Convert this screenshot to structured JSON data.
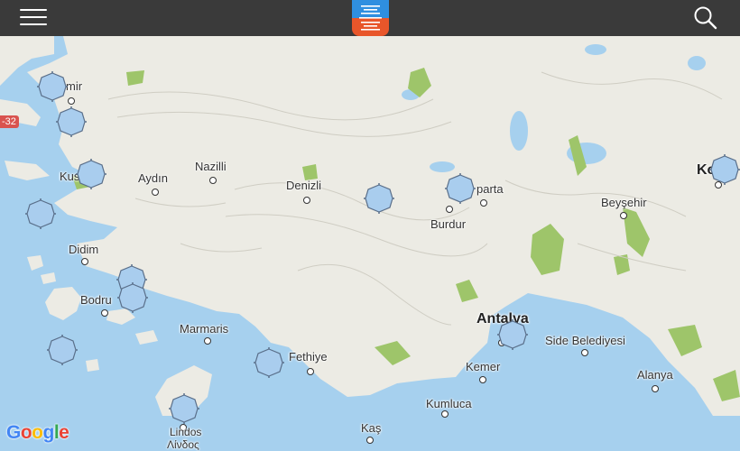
{
  "topbar": {
    "menu_icon": "hamburger-menu-icon",
    "logo_icon": "app-logo-icon",
    "search_icon": "search-icon",
    "color": "#3a3a3a",
    "logo_colors": [
      "#2f8fe0",
      "#e8562a"
    ]
  },
  "map": {
    "attribution": "Google",
    "highway_badge": "-32",
    "colors": {
      "sea": "#a6d0ee",
      "land": "#ecebe4",
      "green": "#9ec56a",
      "marker": "#a9cdee",
      "marker_border": "#5a6f8a"
    },
    "cities": [
      {
        "id": "izmir",
        "label": "mir"
      },
      {
        "id": "kusadasi",
        "label": "Kus"
      },
      {
        "id": "aydin",
        "label": "Aydın"
      },
      {
        "id": "nazilli",
        "label": "Nazilli"
      },
      {
        "id": "denizli",
        "label": "Denizli"
      },
      {
        "id": "isparta",
        "label": "parta"
      },
      {
        "id": "burdur",
        "label": "Burdur"
      },
      {
        "id": "beysehir",
        "label": "Beyşehir"
      },
      {
        "id": "konya",
        "label": "Ko"
      },
      {
        "id": "didim",
        "label": "Didim"
      },
      {
        "id": "bodrum",
        "label": "Bodru"
      },
      {
        "id": "marmaris",
        "label": "Marmaris"
      },
      {
        "id": "fethiye",
        "label": "Fethiye"
      },
      {
        "id": "antalya",
        "label": "Antalya"
      },
      {
        "id": "side",
        "label": "Side Belediyesi"
      },
      {
        "id": "kemer",
        "label": "Kemer"
      },
      {
        "id": "kumluca",
        "label": "Kumluca"
      },
      {
        "id": "alanya",
        "label": "Alanya"
      },
      {
        "id": "kas",
        "label": "Kaş"
      },
      {
        "id": "lindos",
        "label": "Lindos"
      },
      {
        "id": "lindos_gr",
        "label": "Λίνδος"
      }
    ],
    "markers": [
      "location-marker"
    ]
  }
}
